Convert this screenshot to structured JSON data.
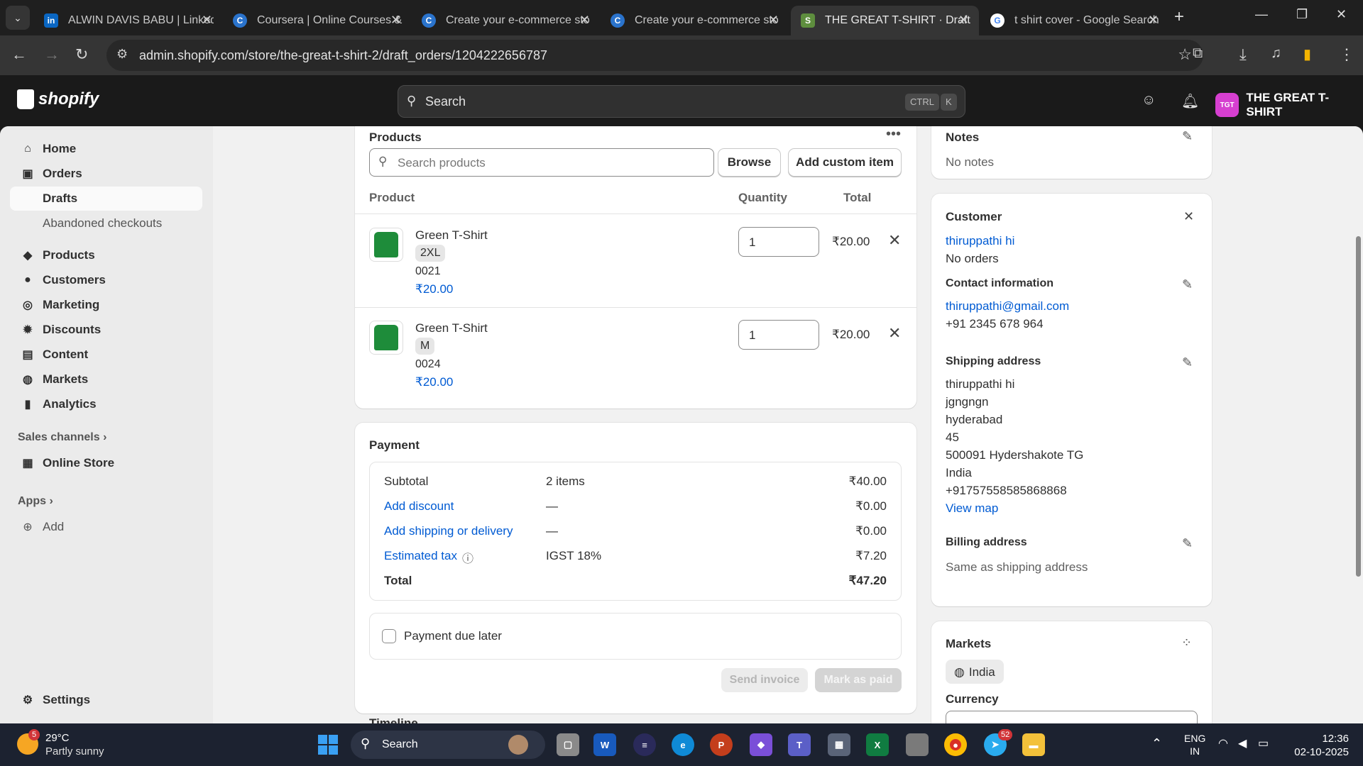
{
  "browser": {
    "tabs": [
      {
        "title": "ALWIN DAVIS BABU | LinkedIn",
        "icon": "linkedin-icon"
      },
      {
        "title": "Coursera | Online Courses &",
        "icon": "coursera-icon"
      },
      {
        "title": "Create your e-commerce sto",
        "icon": "coursera-icon"
      },
      {
        "title": "Create your e-commerce sto",
        "icon": "coursera-icon"
      },
      {
        "title": "THE GREAT T-SHIRT · Drafts",
        "icon": "shopify-icon"
      },
      {
        "title": "t shirt cover - Google Search",
        "icon": "google-icon"
      }
    ],
    "url": "admin.shopify.com/store/the-great-t-shirt-2/draft_orders/1204222656787"
  },
  "header": {
    "brand": "shopify",
    "search_label": "Search",
    "kbd1": "CTRL",
    "kbd2": "K",
    "store_initials": "TGT",
    "store_name": "THE GREAT T-SHIRT"
  },
  "sidebar": {
    "items": [
      {
        "label": "Home"
      },
      {
        "label": "Orders"
      },
      {
        "label": "Drafts"
      },
      {
        "label": "Abandoned checkouts"
      },
      {
        "label": "Products"
      },
      {
        "label": "Customers"
      },
      {
        "label": "Marketing"
      },
      {
        "label": "Discounts"
      },
      {
        "label": "Content"
      },
      {
        "label": "Markets"
      },
      {
        "label": "Analytics"
      }
    ],
    "sales_channels": "Sales channels",
    "online_store": "Online Store",
    "apps": "Apps",
    "add": "Add",
    "settings": "Settings"
  },
  "products": {
    "title": "Products",
    "search_placeholder": "Search products",
    "browse": "Browse",
    "add_custom": "Add custom item",
    "col_product": "Product",
    "col_qty": "Quantity",
    "col_total": "Total",
    "items": [
      {
        "name": "Green T-Shirt",
        "variant": "2XL",
        "sku": "0021",
        "price": "₹20.00",
        "qty": "1",
        "total": "₹20.00"
      },
      {
        "name": "Green T-Shirt",
        "variant": "M",
        "sku": "0024",
        "price": "₹20.00",
        "qty": "1",
        "total": "₹20.00"
      }
    ]
  },
  "payment": {
    "title": "Payment",
    "subtotal_label": "Subtotal",
    "subtotal_mid": "2 items",
    "subtotal_val": "₹40.00",
    "discount_label": "Add discount",
    "discount_mid": "—",
    "discount_val": "₹0.00",
    "shipping_label": "Add shipping or delivery",
    "shipping_mid": "—",
    "shipping_val": "₹0.00",
    "tax_label": "Estimated tax",
    "tax_mid": "IGST 18%",
    "tax_val": "₹7.20",
    "total_label": "Total",
    "total_val": "₹47.20",
    "due_later": "Payment due later",
    "send_invoice": "Send invoice",
    "mark_paid": "Mark as paid",
    "timeline": "Timeline"
  },
  "notes": {
    "title": "Notes",
    "text": "No notes"
  },
  "customer": {
    "title": "Customer",
    "name": "thiruppathi hi",
    "orders": "No orders",
    "contact_title": "Contact information",
    "email": "thiruppathi@gmail.com",
    "phone": "+91 2345 678 964",
    "shipping_title": "Shipping address",
    "ship_lines": [
      "thiruppathi hi",
      "jgngngn",
      "hyderabad",
      "45",
      "500091 Hydershakote TG",
      "India",
      "+917575585858688​68"
    ],
    "view_map": "View map",
    "billing_title": "Billing address",
    "billing_text": "Same as shipping address"
  },
  "markets": {
    "title": "Markets",
    "market": "India",
    "currency": "Currency"
  },
  "taskbar": {
    "weather_temp": "29°C",
    "weather_text": "Partly sunny",
    "weather_badge": "5",
    "search": "Search",
    "lang1": "ENG",
    "lang2": "IN",
    "time": "12:36",
    "date": "02-10-2025",
    "telegram_badge": "52"
  }
}
